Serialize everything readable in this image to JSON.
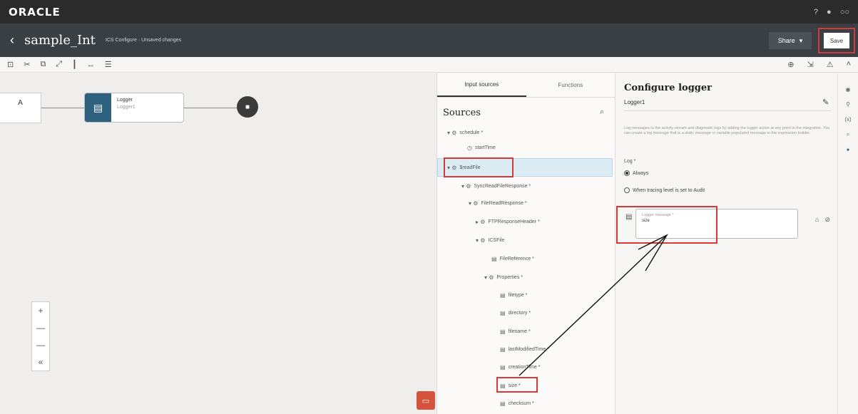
{
  "topbar": {
    "logo": "ORACLE",
    "icons": [
      "help-icon",
      "bell-icon",
      "user-icon"
    ]
  },
  "header": {
    "back_icon": "chevron-left-icon",
    "title": "sample_Int",
    "subtitle": "ICS Configure · Unsaved changes",
    "share_label": "Share",
    "save_label": "Save"
  },
  "toolbar": {
    "left_icons": [
      "select-icon",
      "cut-icon",
      "copy-icon",
      "expand-icon",
      "layout-vertical-icon",
      "layout-horizontal-icon",
      "layout-pancake-icon"
    ],
    "right_icons": [
      "zoom-icon",
      "fit-icon",
      "warning-icon"
    ]
  },
  "canvas": {
    "left_node_marker": "A",
    "logger_node": {
      "title": "Logger",
      "subtitle": "Logger1"
    },
    "end_icon": "stop-icon",
    "zoom_controls": [
      "+",
      "—",
      "—",
      "«"
    ]
  },
  "sources_panel": {
    "tabs": [
      {
        "label": "Input sources",
        "active": true
      },
      {
        "label": "Functions",
        "active": false
      }
    ],
    "title": "Sources",
    "tree": [
      {
        "label": "schedule *"
      },
      {
        "label": "startTime"
      },
      {
        "label": "$readFile"
      },
      {
        "label": "SyncReadFileResponse *"
      },
      {
        "label": "FileReadResponse *"
      },
      {
        "label": "FTPResponseHeader *"
      },
      {
        "label": "ICSFile"
      },
      {
        "label": "FileReference *"
      },
      {
        "label": "Properties *"
      },
      {
        "label": "filetype *"
      },
      {
        "label": "directory *"
      },
      {
        "label": "filename *"
      },
      {
        "label": "lastModifiedTime *"
      },
      {
        "label": "creationTime *"
      },
      {
        "label": "size *"
      },
      {
        "label": "checksum *"
      }
    ]
  },
  "config_panel": {
    "title": "Configure logger",
    "name": "Logger1",
    "description": "Log messages to the activity stream and diagnostic logs by adding the logger action at any point in the integration. You can create a log message that is a static message or variable-populated message in the expression builder.",
    "log_label": "Log *",
    "options": [
      {
        "label": "Always",
        "selected": true
      },
      {
        "label": "When tracing level is set to Audit",
        "selected": false
      }
    ],
    "message_label": "Logger message *",
    "message_value": "size"
  },
  "right_rail": {
    "icons": [
      "properties-icon",
      "wrench-icon",
      "variables-icon",
      "search-icon",
      "tracking-icon"
    ],
    "labels": [
      "(x)"
    ]
  },
  "chat_icon": "chat-icon"
}
